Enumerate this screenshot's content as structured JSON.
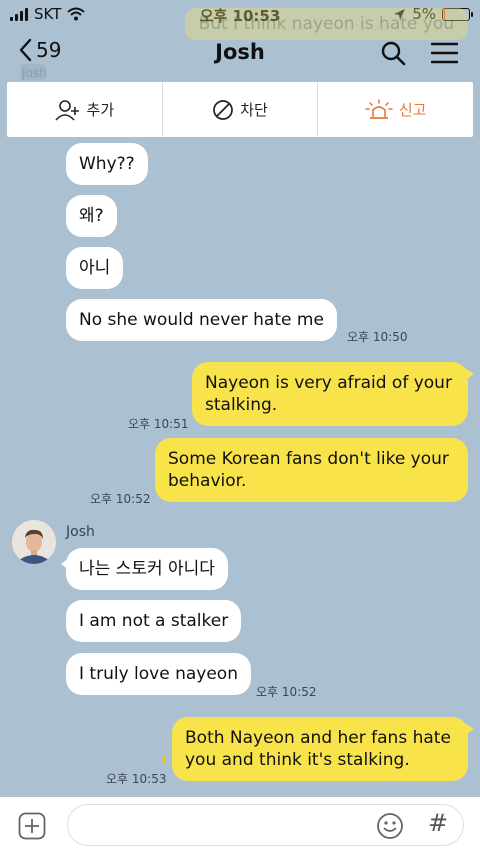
{
  "status": {
    "carrier": "SKT",
    "time": "오후 10:53",
    "battery": "5%",
    "battery_level": 0.05
  },
  "ghost": {
    "preview_text": "But I think nayeon is hate you",
    "sender": "Josh"
  },
  "header": {
    "back_count": "59",
    "title": "Josh"
  },
  "actions": {
    "add": "추가",
    "block": "차단",
    "report": "신고"
  },
  "messages": {
    "m1": "Why??",
    "m2": "왜?",
    "m3": "아니",
    "m4": "No she would never hate me",
    "t4": "오후 10:50",
    "m5_l1": "Nayeon is very afraid of your",
    "m5_l2": "stalking.",
    "t5": "오후 10:51",
    "m6_l1": "Some Korean fans don't like your",
    "m6_l2": "behavior.",
    "t6": "오후 10:52",
    "sender": "Josh",
    "m7": "나는 스토커 아니다",
    "m8": "I am not a stalker",
    "m9": "I truly love nayeon",
    "t9": "오후 10:52",
    "m10_l1": "Both Nayeon and her fans hate",
    "m10_l2": "you and think it's stalking.",
    "t10": "오후 10:53",
    "unread10": "1"
  },
  "input": {
    "placeholder": "",
    "value": "",
    "hash_symbol": "#"
  },
  "colors": {
    "background": "#abc1d1",
    "my_bubble": "#f9e34b",
    "their_bubble": "#ffffff",
    "report_accent": "#e8773a"
  }
}
